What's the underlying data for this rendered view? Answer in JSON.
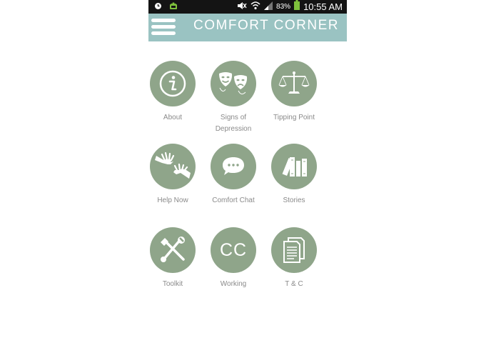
{
  "status_bar": {
    "battery_percent": "83%",
    "time": "10:55 AM",
    "icons": [
      "alarm-icon",
      "android-debug-icon",
      "mute-icon",
      "wifi-icon",
      "signal-icon",
      "battery-icon"
    ]
  },
  "app_bar": {
    "title": "COMFORT CORNER",
    "menu_icon": "hamburger-menu-icon"
  },
  "tiles": [
    {
      "label": "About",
      "icon": "info-icon"
    },
    {
      "label": "Signs of\nDepression",
      "icon": "theater-masks-icon"
    },
    {
      "label": "Tipping Point",
      "icon": "balance-scale-icon"
    },
    {
      "label": "Help Now",
      "icon": "reaching-hands-icon"
    },
    {
      "label": "Comfort Chat",
      "icon": "chat-bubble-icon"
    },
    {
      "label": "Stories",
      "icon": "books-icon"
    },
    {
      "label": "Toolkit",
      "icon": "tools-icon"
    },
    {
      "label": "Working",
      "icon": "cc-text",
      "icon_text": "CC"
    },
    {
      "label": "T & C",
      "icon": "documents-icon"
    }
  ],
  "colors": {
    "app_bar": "#9ac3c2",
    "tile_circle": "#8fa58a",
    "label_text": "#8a8a8a",
    "status_bar": "#141414",
    "battery": "#7ec13c"
  }
}
